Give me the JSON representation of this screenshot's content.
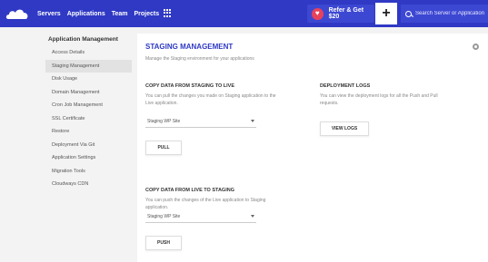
{
  "topbar": {
    "nav": [
      "Servers",
      "Applications",
      "Team",
      "Projects"
    ],
    "refer_label": "Refer & Get $20",
    "search_placeholder": "Search Server or Application"
  },
  "sidebar": {
    "title": "Application Management",
    "items": [
      "Access Details",
      "Staging Management",
      "Disk Usage",
      "Domain Management",
      "Cron Job Management",
      "SSL Certificate",
      "Restore",
      "Deployment Via Git",
      "Application Settings",
      "Migration Tools",
      "Cloudways CDN"
    ],
    "active_index": 1
  },
  "main": {
    "title": "STAGING MANAGEMENT",
    "subtitle": "Manage the Staging environment for your applications",
    "staging_to_live": {
      "title": "COPY DATA FROM STAGING TO LIVE",
      "desc1": "You can pull the changes you made on Staging application to the",
      "desc2": "Live application.",
      "select_value": "Staging WP Site",
      "button": "PULL"
    },
    "live_to_staging": {
      "title": "COPY DATA FROM LIVE TO STAGING",
      "desc1": "You can push the changes of the Live application to Staging",
      "desc2": "application.",
      "select_value": "Staging WP Site",
      "button": "PUSH"
    },
    "deployment_logs": {
      "title": "DEPLOYMENT LOGS",
      "desc1": "You can view the deployment logs for all the Push and Pull",
      "desc2": "requests.",
      "button": "VIEW LOGS"
    }
  },
  "colors": {
    "topbar": "#2f39c4",
    "accent": "#2f39c4",
    "heart": "#e8415b"
  }
}
